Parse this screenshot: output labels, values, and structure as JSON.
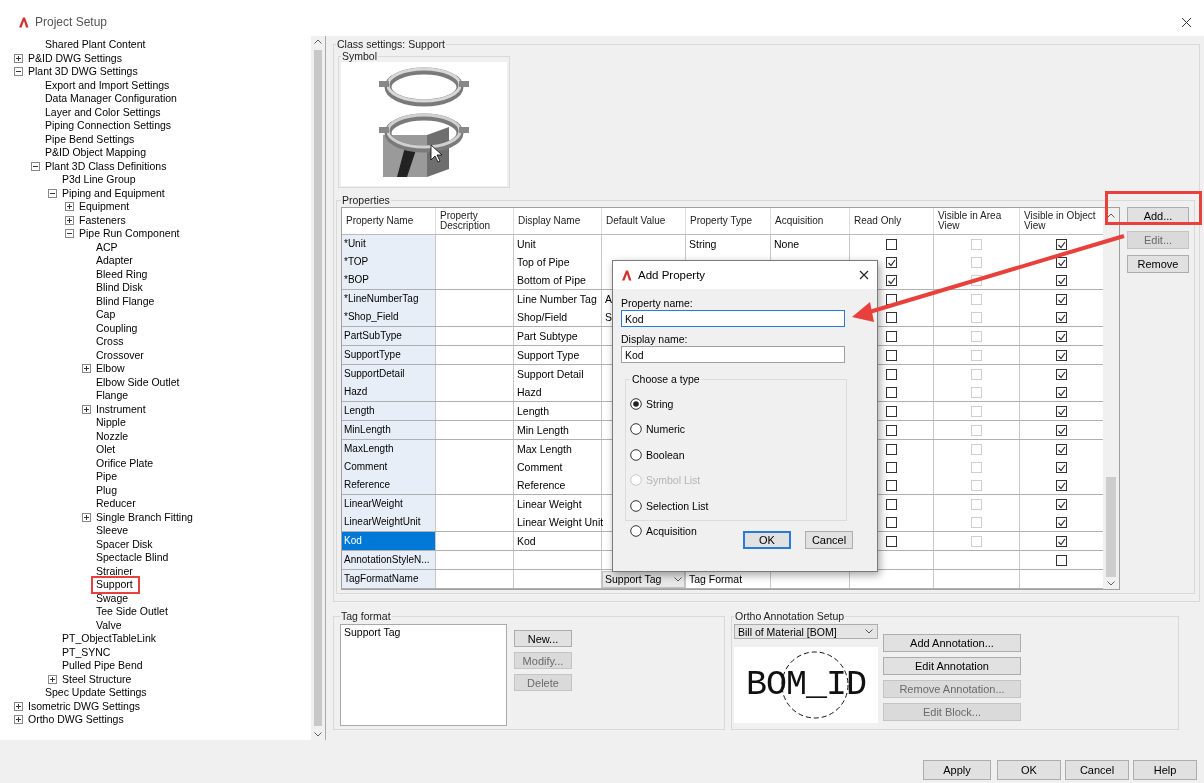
{
  "window": {
    "title": "Project Setup"
  },
  "tree": {
    "clipped_children": [
      {
        "label": "Shared Plant Content",
        "selected": false
      }
    ],
    "items": [
      {
        "label": "P&ID DWG Settings",
        "kind": "group",
        "expanded": false,
        "selected": false
      },
      {
        "label": "Plant 3D DWG Settings",
        "kind": "group",
        "expanded": true,
        "selected": false,
        "children": [
          {
            "label": "Export and Import Settings",
            "kind": "leaf",
            "selected": false
          },
          {
            "label": "Data Manager Configuration",
            "kind": "leaf",
            "selected": false
          },
          {
            "label": "Layer and Color Settings",
            "kind": "leaf",
            "selected": false
          },
          {
            "label": "Piping Connection Settings",
            "kind": "leaf",
            "selected": false
          },
          {
            "label": "Pipe Bend Settings",
            "kind": "leaf",
            "selected": false
          },
          {
            "label": "P&ID Object Mapping",
            "kind": "leaf",
            "selected": false
          },
          {
            "label": "Plant 3D Class Definitions",
            "kind": "group",
            "expanded": true,
            "selected": false,
            "children": [
              {
                "label": "P3d Line Group",
                "kind": "leaf",
                "selected": false
              },
              {
                "label": "Piping and Equipment",
                "kind": "group",
                "expanded": true,
                "selected": false,
                "children": [
                  {
                    "label": "Equipment",
                    "kind": "group",
                    "expanded": false,
                    "selected": false
                  },
                  {
                    "label": "Fasteners",
                    "kind": "group",
                    "expanded": false,
                    "selected": false
                  },
                  {
                    "label": "Pipe Run Component",
                    "kind": "group",
                    "expanded": true,
                    "selected": false,
                    "children": [
                      {
                        "label": "ACP",
                        "kind": "leaf",
                        "selected": false
                      },
                      {
                        "label": "Adapter",
                        "kind": "leaf",
                        "selected": false
                      },
                      {
                        "label": "Bleed Ring",
                        "kind": "leaf",
                        "selected": false
                      },
                      {
                        "label": "Blind Disk",
                        "kind": "leaf",
                        "selected": false
                      },
                      {
                        "label": "Blind Flange",
                        "kind": "leaf",
                        "selected": false
                      },
                      {
                        "label": "Cap",
                        "kind": "leaf",
                        "selected": false
                      },
                      {
                        "label": "Coupling",
                        "kind": "leaf",
                        "selected": false
                      },
                      {
                        "label": "Cross",
                        "kind": "leaf",
                        "selected": false
                      },
                      {
                        "label": "Crossover",
                        "kind": "leaf",
                        "selected": false
                      },
                      {
                        "label": "Elbow",
                        "kind": "group",
                        "expanded": false,
                        "selected": false
                      },
                      {
                        "label": "Elbow Side Outlet",
                        "kind": "leaf",
                        "selected": false
                      },
                      {
                        "label": "Flange",
                        "kind": "leaf",
                        "selected": false
                      },
                      {
                        "label": "Instrument",
                        "kind": "group",
                        "expanded": false,
                        "selected": false
                      },
                      {
                        "label": "Nipple",
                        "kind": "leaf",
                        "selected": false
                      },
                      {
                        "label": "Nozzle",
                        "kind": "leaf",
                        "selected": false
                      },
                      {
                        "label": "Olet",
                        "kind": "leaf",
                        "selected": false
                      },
                      {
                        "label": "Orifice Plate",
                        "kind": "leaf",
                        "selected": false
                      },
                      {
                        "label": "Pipe",
                        "kind": "leaf",
                        "selected": false
                      },
                      {
                        "label": "Plug",
                        "kind": "leaf",
                        "selected": false
                      },
                      {
                        "label": "Reducer",
                        "kind": "leaf",
                        "selected": false
                      },
                      {
                        "label": "Single Branch Fitting",
                        "kind": "group",
                        "expanded": false,
                        "selected": false
                      },
                      {
                        "label": "Sleeve",
                        "kind": "leaf",
                        "selected": false
                      },
                      {
                        "label": "Spacer Disk",
                        "kind": "leaf",
                        "selected": false
                      },
                      {
                        "label": "Spectacle Blind",
                        "kind": "leaf",
                        "selected": false
                      },
                      {
                        "label": "Strainer",
                        "kind": "leaf",
                        "selected": false
                      },
                      {
                        "label": "Support",
                        "kind": "leaf",
                        "selected": true
                      },
                      {
                        "label": "Swage",
                        "kind": "leaf",
                        "selected": false
                      },
                      {
                        "label": "Tee Side Outlet",
                        "kind": "leaf",
                        "selected": false
                      },
                      {
                        "label": "Valve",
                        "kind": "leaf",
                        "selected": false
                      }
                    ]
                  }
                ]
              },
              {
                "label": "PT_ObjectTableLink",
                "kind": "leaf",
                "selected": false
              },
              {
                "label": "PT_SYNC",
                "kind": "leaf",
                "selected": false
              },
              {
                "label": "Pulled Pipe Bend",
                "kind": "leaf",
                "selected": false
              },
              {
                "label": "Steel Structure",
                "kind": "group",
                "expanded": false,
                "selected": false
              }
            ]
          },
          {
            "label": "Spec Update Settings",
            "kind": "leaf",
            "selected": false
          }
        ]
      },
      {
        "label": "Isometric DWG Settings",
        "kind": "group",
        "expanded": false,
        "selected": false
      },
      {
        "label": "Ortho DWG Settings",
        "kind": "group",
        "expanded": false,
        "selected": false
      }
    ]
  },
  "class_settings": {
    "title": "Class settings: Support",
    "symbol_title": "Symbol"
  },
  "properties": {
    "title": "Properties",
    "columns": [
      "Property Name",
      "Property Description",
      "Display Name",
      "Default Value",
      "Property Type",
      "Acquisition",
      "Read Only",
      "Visible in Area View",
      "Visible in Object View"
    ],
    "groups": [
      {
        "rows": [
          {
            "property_name": "*Unit",
            "display_name": "Unit",
            "property_type": "String",
            "acquisition": "None",
            "selected": false,
            "read_only": {
              "checked": false,
              "disabled": false
            },
            "visible_in_area_view": {
              "checked": false,
              "disabled": true
            },
            "visible_in_object_view": {
              "checked": true,
              "disabled": false
            }
          },
          {
            "property_name": "*TOP",
            "display_name": "Top of Pipe",
            "selected": false,
            "read_only": {
              "checked": true,
              "disabled": false
            },
            "visible_in_area_view": {
              "checked": false,
              "disabled": true
            },
            "visible_in_object_view": {
              "checked": true,
              "disabled": false
            }
          },
          {
            "property_name": "*BOP",
            "display_name": "Bottom of Pipe",
            "selected": false,
            "read_only": {
              "checked": true,
              "disabled": false
            },
            "visible_in_area_view": {
              "checked": false,
              "disabled": true
            },
            "visible_in_object_view": {
              "checked": true,
              "disabled": false
            }
          }
        ]
      },
      {
        "rows": [
          {
            "property_name": "*LineNumberTag",
            "display_name": "Line Number Tag",
            "default_value": "A",
            "selected": false,
            "read_only": {
              "checked": false,
              "disabled": false
            },
            "visible_in_area_view": {
              "checked": false,
              "disabled": true
            },
            "visible_in_object_view": {
              "checked": true,
              "disabled": false
            }
          },
          {
            "property_name": "*Shop_Field",
            "display_name": "Shop/Field",
            "default_value": "S",
            "selected": false,
            "read_only": {
              "checked": false,
              "disabled": false
            },
            "visible_in_area_view": {
              "checked": false,
              "disabled": true
            },
            "visible_in_object_view": {
              "checked": true,
              "disabled": false
            }
          }
        ]
      },
      {
        "rows": [
          {
            "property_name": "PartSubType",
            "display_name": "Part Subtype",
            "selected": false,
            "read_only": {
              "checked": false,
              "disabled": false
            },
            "visible_in_area_view": {
              "checked": false,
              "disabled": true
            },
            "visible_in_object_view": {
              "checked": true,
              "disabled": false
            }
          }
        ]
      },
      {
        "rows": [
          {
            "property_name": "SupportType",
            "display_name": "Support Type",
            "selected": false,
            "read_only": {
              "checked": false,
              "disabled": false
            },
            "visible_in_area_view": {
              "checked": false,
              "disabled": true
            },
            "visible_in_object_view": {
              "checked": true,
              "disabled": false
            }
          }
        ]
      },
      {
        "rows": [
          {
            "property_name": "SupportDetail",
            "display_name": "Support Detail",
            "selected": false,
            "read_only": {
              "checked": false,
              "disabled": false
            },
            "visible_in_area_view": {
              "checked": false,
              "disabled": true
            },
            "visible_in_object_view": {
              "checked": true,
              "disabled": false
            }
          },
          {
            "property_name": "Hazd",
            "display_name": "Hazd",
            "selected": false,
            "read_only": {
              "checked": false,
              "disabled": false
            },
            "visible_in_area_view": {
              "checked": false,
              "disabled": true
            },
            "visible_in_object_view": {
              "checked": true,
              "disabled": false
            }
          }
        ]
      },
      {
        "rows": [
          {
            "property_name": "Length",
            "display_name": "Length",
            "selected": false,
            "read_only": {
              "checked": false,
              "disabled": false
            },
            "visible_in_area_view": {
              "checked": false,
              "disabled": true
            },
            "visible_in_object_view": {
              "checked": true,
              "disabled": false
            }
          }
        ]
      },
      {
        "rows": [
          {
            "property_name": "MinLength",
            "display_name": "Min Length",
            "selected": false,
            "read_only": {
              "checked": false,
              "disabled": false
            },
            "visible_in_area_view": {
              "checked": false,
              "disabled": true
            },
            "visible_in_object_view": {
              "checked": true,
              "disabled": false
            }
          }
        ]
      },
      {
        "rows": [
          {
            "property_name": "MaxLength",
            "display_name": "Max Length",
            "selected": false,
            "read_only": {
              "checked": false,
              "disabled": false
            },
            "visible_in_area_view": {
              "checked": false,
              "disabled": true
            },
            "visible_in_object_view": {
              "checked": true,
              "disabled": false
            }
          },
          {
            "property_name": "Comment",
            "display_name": "Comment",
            "selected": false,
            "read_only": {
              "checked": false,
              "disabled": false
            },
            "visible_in_area_view": {
              "checked": false,
              "disabled": true
            },
            "visible_in_object_view": {
              "checked": true,
              "disabled": false
            }
          },
          {
            "property_name": "Reference",
            "display_name": "Reference",
            "selected": false,
            "read_only": {
              "checked": false,
              "disabled": false
            },
            "visible_in_area_view": {
              "checked": false,
              "disabled": true
            },
            "visible_in_object_view": {
              "checked": true,
              "disabled": false
            }
          }
        ]
      },
      {
        "rows": [
          {
            "property_name": "LinearWeight",
            "display_name": "Linear Weight",
            "selected": false,
            "read_only": {
              "checked": false,
              "disabled": false
            },
            "visible_in_area_view": {
              "checked": false,
              "disabled": true
            },
            "visible_in_object_view": {
              "checked": true,
              "disabled": false
            }
          },
          {
            "property_name": "LinearWeightUnit",
            "display_name": "Linear Weight Unit",
            "selected": false,
            "read_only": {
              "checked": false,
              "disabled": false
            },
            "visible_in_area_view": {
              "checked": false,
              "disabled": true
            },
            "visible_in_object_view": {
              "checked": true,
              "disabled": false
            }
          }
        ]
      },
      {
        "rows": [
          {
            "property_name": "Kod",
            "display_name": "Kod",
            "selected": true,
            "read_only": {
              "checked": false,
              "disabled": false
            },
            "visible_in_area_view": {
              "checked": false,
              "disabled": true
            },
            "visible_in_object_view": {
              "checked": true,
              "disabled": false
            }
          }
        ]
      },
      {
        "rows": [
          {
            "property_name": "AnnotationStyleN...",
            "selected": false,
            "visible_in_object_view": {
              "checked": false,
              "disabled": false
            }
          }
        ]
      },
      {
        "rows": [
          {
            "property_name": "TagFormatName",
            "default_value": {
              "kind": "dropdown",
              "text": "Support Tag"
            },
            "property_type": "Tag Format",
            "selected": false
          }
        ]
      }
    ],
    "buttons": [
      {
        "label": "Add...",
        "disabled": false,
        "highlighted": true
      },
      {
        "label": "Edit...",
        "disabled": true,
        "highlighted": false
      },
      {
        "label": "Remove",
        "disabled": false,
        "highlighted": false
      }
    ]
  },
  "tag_format": {
    "title": "Tag format",
    "items": [
      {
        "label": "Support Tag",
        "selected": false
      }
    ],
    "buttons": [
      {
        "label": "New...",
        "disabled": false
      },
      {
        "label": "Modify...",
        "disabled": true
      },
      {
        "label": "Delete",
        "disabled": true
      }
    ]
  },
  "ortho_annotation": {
    "title": "Ortho Annotation Setup",
    "dropdown": "Bill of Material [BOM]",
    "preview_text": "BOM_ID",
    "buttons": [
      {
        "label": "Add Annotation...",
        "disabled": false
      },
      {
        "label": "Edit Annotation",
        "disabled": false
      },
      {
        "label": "Remove Annotation...",
        "disabled": true
      },
      {
        "label": "Edit Block...",
        "disabled": true
      }
    ]
  },
  "footer_buttons": [
    {
      "label": "Apply",
      "disabled": false
    },
    {
      "label": "OK",
      "disabled": false
    },
    {
      "label": "Cancel",
      "disabled": false
    },
    {
      "label": "Help",
      "disabled": false
    }
  ],
  "dialog": {
    "title": "Add Property",
    "property_name_label": "Property name:",
    "property_name": "Kod",
    "display_name_label": "Display name:",
    "display_name": "Kod",
    "type_group": "Choose a type",
    "types": [
      {
        "label": "String",
        "selected": true,
        "disabled": false
      },
      {
        "label": "Numeric",
        "selected": false,
        "disabled": false
      },
      {
        "label": "Boolean",
        "selected": false,
        "disabled": false
      },
      {
        "label": "Symbol List",
        "selected": false,
        "disabled": true
      },
      {
        "label": "Selection List",
        "selected": false,
        "disabled": false
      },
      {
        "label": "Acquisition",
        "selected": false,
        "disabled": false
      }
    ],
    "buttons": [
      {
        "label": "OK",
        "default": true
      },
      {
        "label": "Cancel",
        "default": false
      }
    ]
  }
}
